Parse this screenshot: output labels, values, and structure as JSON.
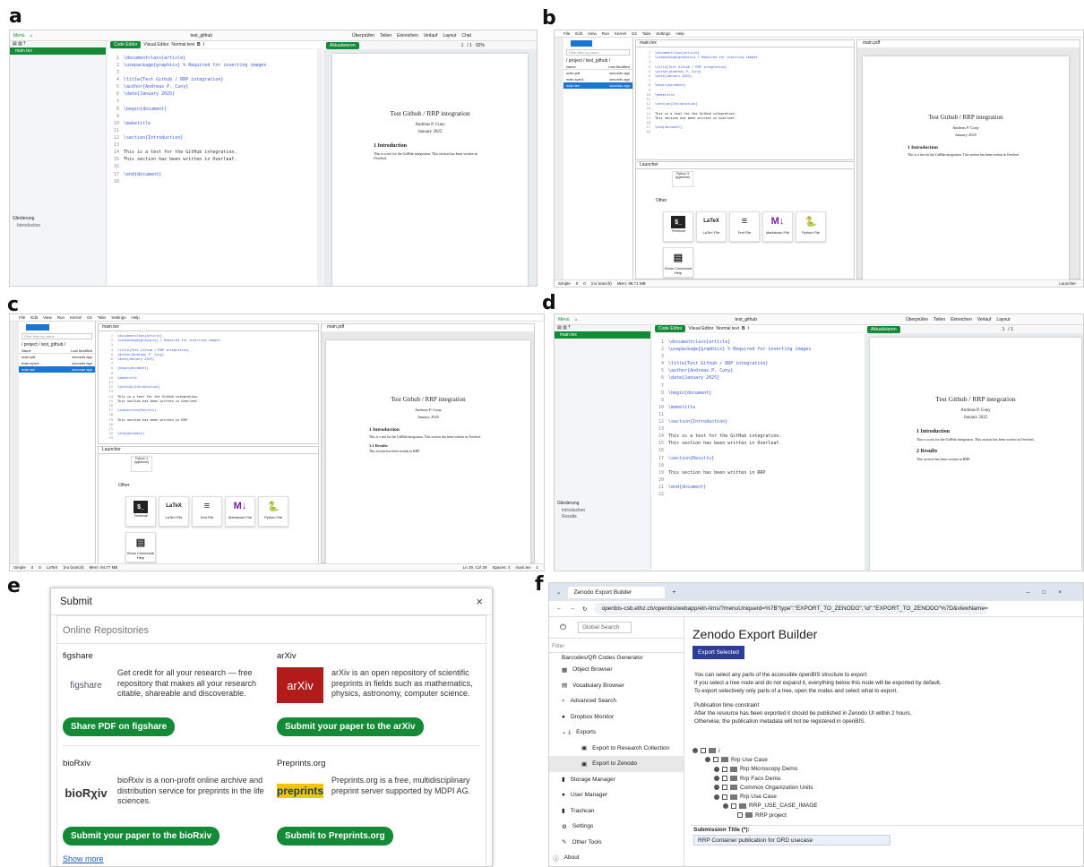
{
  "labels": {
    "a": "a",
    "b": "b",
    "c": "c",
    "d": "d",
    "e": "e",
    "f": "f"
  },
  "overleaf_a": {
    "menu": "Menü",
    "project": "test_github",
    "actions": [
      "Überprüfen",
      "Teilen",
      "Einreichen",
      "Verlauf",
      "Layout",
      "Chat"
    ],
    "file": "main.tex",
    "tab_code": "Code Editor",
    "tab_visual": "Visual Editor",
    "style": "Normal text",
    "recompile": "Aktualisieren",
    "page": "1",
    "pages": "/ 1",
    "zoom": "92%",
    "outline": "Gliederung",
    "outline_items": [
      "Introduction"
    ],
    "code": [
      "\\documentclass{article}",
      "\\usepackage{graphicx} % Required for inserting images",
      "",
      "\\title{Test Github / RRP integration}",
      "\\author{Andreas P. Cuny}",
      "\\date{January 2025}",
      "",
      "\\begin{document}",
      "",
      "\\maketitle",
      "",
      "\\section{Introduction}",
      "",
      "This is a test for the GitHub integration.",
      "This section has been written in Overleaf.",
      "",
      "\\end{document}",
      ""
    ],
    "pdf": {
      "title": "Test Github / RRP integration",
      "author": "Andreas P. Cuny",
      "date": "January 2025",
      "sec": "1   Introduction",
      "body": "This is a test for the GitHub integration. This section has been written in Overleaf."
    }
  },
  "jupyter_b": {
    "menu": [
      "File",
      "Edit",
      "View",
      "Run",
      "Kernel",
      "Git",
      "Tabs",
      "Settings",
      "Help"
    ],
    "filter": "Filter files by name",
    "path": "/ project / test_github /",
    "cols": [
      "Name",
      "Last Modified"
    ],
    "files": [
      {
        "name": "main.pdf",
        "time": "seconds ago"
      },
      {
        "name": "main.synct...",
        "time": "seconds ago"
      },
      {
        "name": "main.tex",
        "time": "seconds ago"
      }
    ],
    "tab_tex": "main.tex",
    "tab_pdf": "main.pdf",
    "tab_launcher": "Launcher",
    "code": [
      "\\documentclass{article}",
      "\\usepackage{graphicx} % Required for inserting images",
      "",
      "\\title{Test Github / RRP integration}",
      "\\author{Andreas P. Cuny}",
      "\\date{January 2025}",
      "",
      "\\begin{document}",
      "",
      "\\maketitle",
      "",
      "\\section{Introduction}",
      "",
      "This is a test for the GitHub integration.",
      "This section has been written in Overleaf.",
      "",
      "\\end{document}",
      ""
    ],
    "launcher": {
      "python": "Python 3 (ipykernel)",
      "other": "Other",
      "cards": [
        "Terminal",
        "LaTeX File",
        "Text File",
        "Markdown File",
        "Python File",
        "Show Contextual Help"
      ]
    },
    "status": [
      "Simple",
      "0",
      "0",
      "(no branch)",
      "Mem: 99.71 MB",
      "Launcher"
    ],
    "pdf": {
      "title": "Test Github / RRP integration",
      "author": "Andreas P. Cuny",
      "date": "January 2025",
      "sec": "1   Introduction",
      "body": "This is a test for the GitHub integration. This section has been written in Overleaf."
    }
  },
  "jupyter_c": {
    "code": [
      "\\documentclass{article}",
      "\\usepackage{graphicx} % Required for inserting images",
      "",
      "\\title{Test Github / RRP integration}",
      "\\author{Andreas P. Cuny}",
      "\\date{January 2025}",
      "",
      "\\begin{document}",
      "",
      "\\maketitle",
      "",
      "\\section{Introduction}",
      "",
      "This is a test for the GitHub integration.",
      "This section has been written in Overleaf.",
      "",
      "\\subsection{Results}",
      "",
      "This section has been written in RRP.",
      "",
      "",
      "\\end{document}",
      ""
    ],
    "status": [
      "Simple",
      "0",
      "0",
      "LaTeX",
      "(no branch)",
      "Mem: 94.77 MB",
      "Ln 19, Col 39",
      "Spaces: 4",
      "main.tex",
      "1"
    ],
    "pdf": {
      "title": "Test Github / RRP integration",
      "author": "Andreas P. Cuny",
      "date": "January 2025",
      "sec": "1   Introduction",
      "body": "This is a test for the GitHub integration. This section has been written in Overleaf.",
      "sub": "1.1   Results",
      "sub_body": "This section has been written in RRP."
    }
  },
  "overleaf_d": {
    "menu": "Menü",
    "project": "test_github",
    "actions": [
      "Überprüfen",
      "Teilen",
      "Einreichen",
      "Verlauf",
      "Layout"
    ],
    "outline_items": [
      "Introduction",
      "Results"
    ],
    "code": [
      "\\documentclass{article}",
      "\\usepackage{graphicx} % Required for inserting images",
      "",
      "\\title{Test Github / RRP integration}",
      "\\author{Andreas P. Cuny}",
      "\\date{January 2025}",
      "",
      "\\begin{document}",
      "",
      "\\maketitle",
      "",
      "\\section{Introduction}",
      "",
      "This is a test for the GitHub integration.",
      "This section has been written in Overleaf.",
      "",
      "\\section{Results}",
      "",
      "This section has been written in RRP",
      "",
      "\\end{document}",
      ""
    ],
    "pdf": {
      "title": "Test Github / RRP integration",
      "author": "Andreas P. Cuny",
      "date": "January 2025",
      "sec": "1   Introduction",
      "body": "This is a test for the GitHub integration. This section has been written in Overleaf.",
      "sec2": "2   Results",
      "sec2_body": "This section has been written in RRP."
    }
  },
  "submit": {
    "title": "Submit",
    "close": "×",
    "heading": "Online Repositories",
    "repos": [
      {
        "name": "figshare",
        "logo": "figshare",
        "desc": "Get credit for all your research — free repository that makes all your research citable, shareable and discoverable.",
        "button": "Share PDF on figshare"
      },
      {
        "name": "arXiv",
        "logo": "arXiv",
        "desc": "arXiv is an open repository of scientific preprints in fields such as mathematics, physics, astronomy, computer science.",
        "button": "Submit your paper to the arXiv"
      },
      {
        "name": "bioRxiv",
        "logo": "bioRχiv",
        "desc": "bioRxiv is a non-profit online archive and distribution service for preprints in the life sciences.",
        "button": "Submit your paper to the bioRxiv"
      },
      {
        "name": "Preprints.org",
        "logo": "preprints",
        "desc": "Preprints.org is a free, multidisciplinary preprint server supported by MDPI AG.",
        "button": "Submit to Preprints.org"
      }
    ],
    "show_more": "Show more"
  },
  "zenodo": {
    "tab": "Zenodo Export Builder",
    "url": "openbis-csb.ethz.ch/openbis/webapp/eln-lims/?menuUniqueId=%7B\"type\":\"EXPORT_TO_ZENODO\",\"id\":\"EXPORT_TO_ZENODO\"%7D&viewName=showZen...",
    "search": "Global Search",
    "filter": "Filter",
    "nav": [
      "Barcodes/QR Codes Generator",
      "Object Browser",
      "Vocabulary Browser",
      "Advanced Search",
      "Dropbox Monitor",
      "Exports",
      "Export to Research Collection",
      "Export to Zenodo",
      "Storage Manager",
      "User Manager",
      "Trashcan",
      "Settings",
      "Other Tools",
      "About"
    ],
    "heading": "Zenodo Export Builder",
    "export_btn": "Export Selected",
    "info": [
      "You can select any parts of the accessible openBIS structure to export:",
      "If you select a tree node and do not expand it, everything below this node will be exported by default.",
      "To export selectively only parts of a tree, open the nodes and select what to export."
    ],
    "constraint": [
      "Publication time constraint",
      "After the resource has been exported it should be published in Zenodo UI within 2 hours.",
      "Otherwise, the publication metadata will not be registered in openBIS."
    ],
    "tree": [
      "/",
      "Rrp Use Case",
      "Rrp Microscopy Demo",
      "Rrp Facs Demo",
      "Common Organization Units",
      "Rrp Use Case",
      "RRP_USE_CASE_IMAGE",
      "RRP project"
    ],
    "sub_title_label": "Submission Title (*):",
    "sub_title_value": "RRP Container publication for ORD usecase"
  }
}
